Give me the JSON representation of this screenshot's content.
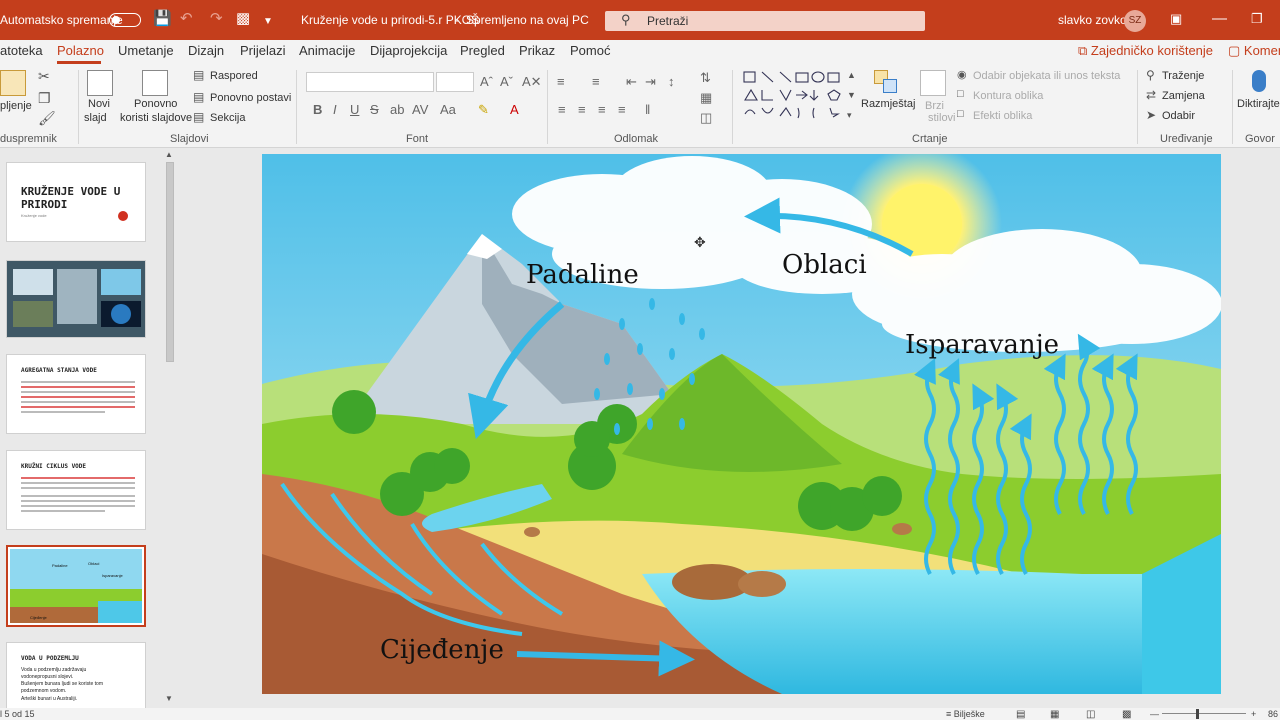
{
  "title_bar": {
    "autosave_label": "Automatsko spremanje",
    "doc_title": "Kruženje vode u prirodi-5.r PKOŠ",
    "save_status": "Spremljeno na ovaj PC",
    "search_placeholder": "Pretraži",
    "user_name": "slavko zovko",
    "user_initials": "SZ"
  },
  "tabs": [
    "atoteka",
    "Polazno",
    "Umetanje",
    "Dizajn",
    "Prijelazi",
    "Animacije",
    "Dijaprojekcija",
    "Pregled",
    "Prikaz",
    "Pomoć"
  ],
  "share": {
    "label": "Zajedničko korištenje",
    "comments": "Komen"
  },
  "ribbon": {
    "clipboard": {
      "paste": "pljenje",
      "group": "duspremnik"
    },
    "slides": {
      "new_slide": "Novi",
      "new_slide2": "slajd",
      "reuse": "Ponovno",
      "reuse2": "koristi slajdove",
      "layout": "Raspored",
      "reset": "Ponovno postavi",
      "section": "Sekcija",
      "group": "Slajdovi"
    },
    "font": {
      "group": "Font"
    },
    "paragraph": {
      "group": "Odlomak"
    },
    "drawing": {
      "arrange": "Razmještaj",
      "quick_styles": "Brzi",
      "quick_styles2": "stilovi",
      "select_objects": "Odabir objekata ili unos teksta",
      "outline": "Kontura oblika",
      "effects": "Efekti oblika",
      "group": "Crtanje"
    },
    "editing": {
      "find": "Traženje",
      "replace": "Zamjena",
      "select": "Odabir",
      "group": "Uređivanje"
    },
    "voice": {
      "dictate": "Diktirajte",
      "group": "Govor"
    }
  },
  "thumbnails": {
    "t1_title": "KRUŽENJE VODE U PRIRODI",
    "t1_sub": "Kruženje vode",
    "t3_title": "AGREGATNA STANJA VODE",
    "t4_title": "KRUŽNI CIKLUS VODE",
    "t5_labels": [
      "Padaline",
      "Oblaci",
      "Isparavanje",
      "Cijeđenje"
    ],
    "t6_title": "VODA U PODZEMLJU",
    "t6_lines": [
      "Voda u podzemlju zadržavaju",
      "vodonepropusni slojevi.",
      "Bušenjem bunara ljudi se koriste tom",
      "podzemnom vodom.",
      "Arteški bunari u Australiji."
    ]
  },
  "slide_labels": {
    "precipitation": "Padaline",
    "clouds": "Oblaci",
    "evaporation": "Isparavanje",
    "infiltration": "Cijeđenje"
  },
  "status_bar": {
    "slide_counter": "l 5 od 15",
    "notes": "Bilješke",
    "zoom": "86"
  },
  "colors": {
    "accent": "#c43e1c",
    "sky": "#7fd0ef",
    "grass": "#8ccd2e",
    "water": "#5fd3ea"
  }
}
